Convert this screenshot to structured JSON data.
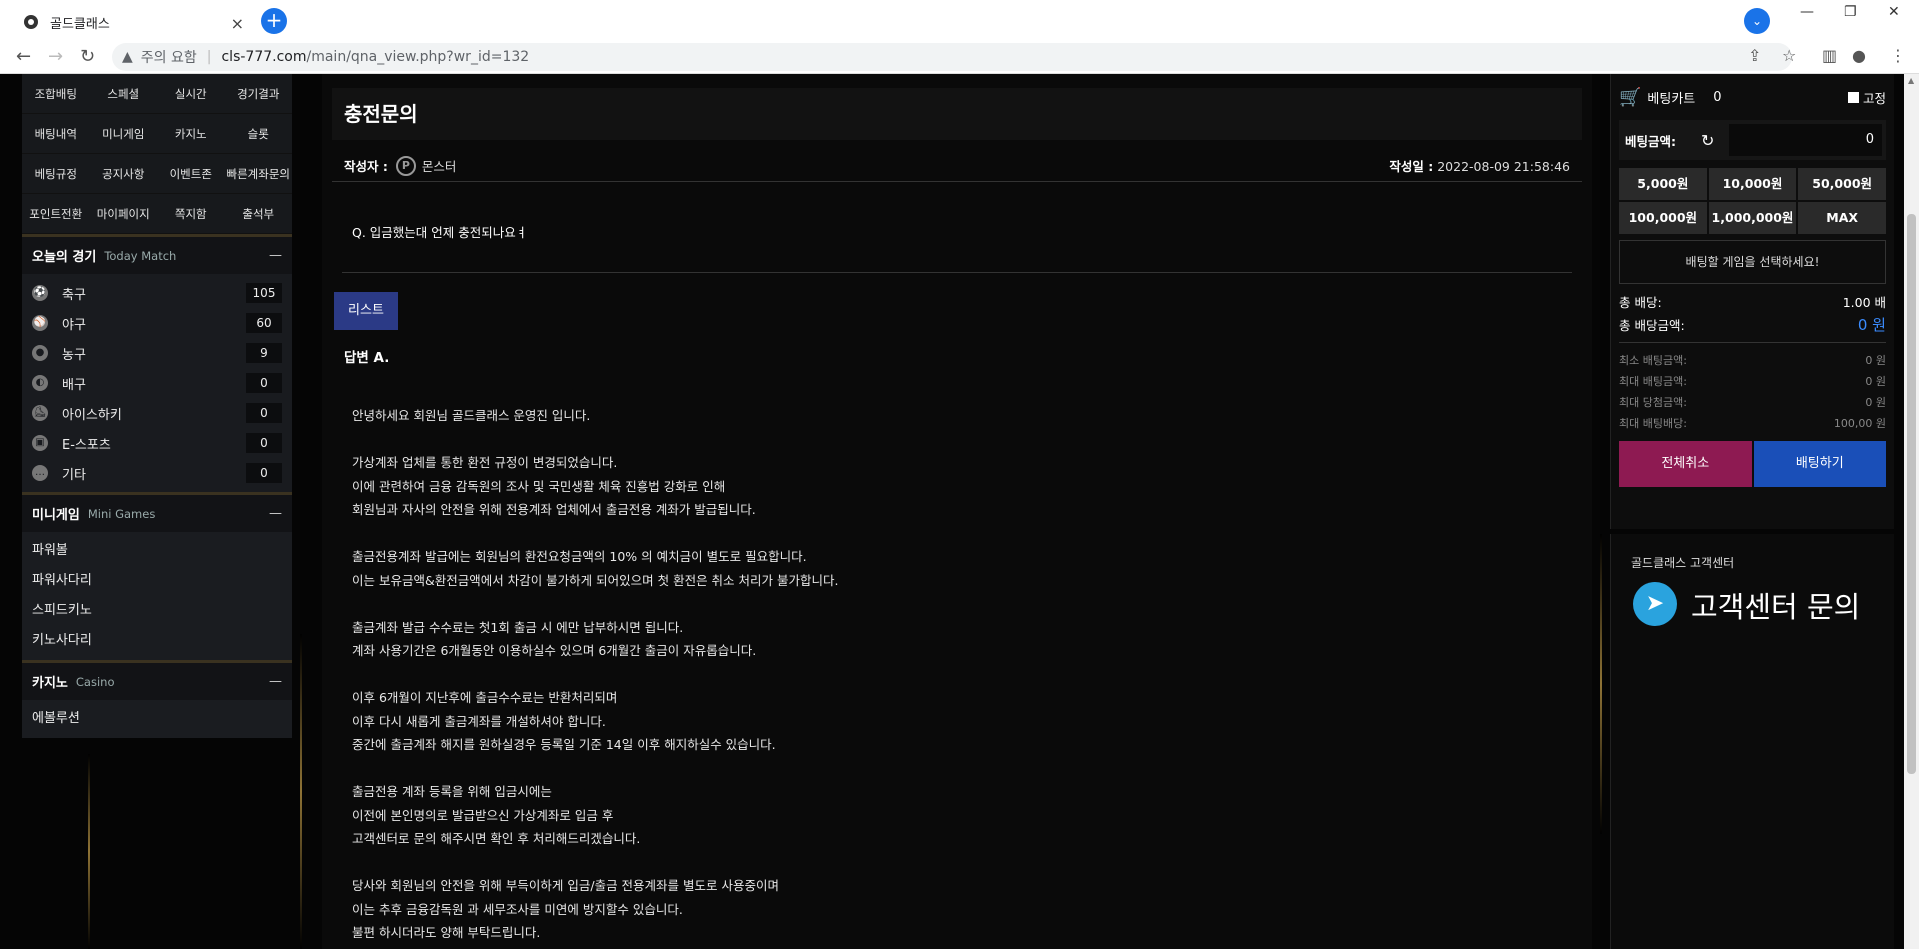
{
  "browser": {
    "tab_title": "골드클래스",
    "tab_close": "×",
    "new_tab": "+",
    "security_label": "주의 요함",
    "url_host": "cls-777.com",
    "url_path": "/main/qna_view.php?wr_id=132"
  },
  "nav_menu": [
    "조합배팅",
    "스페셜",
    "실시간",
    "경기결과",
    "배팅내역",
    "미니게임",
    "카지노",
    "슬롯",
    "베팅규정",
    "공지사항",
    "이벤트존",
    "빠른계좌문의",
    "포인트전환",
    "마이페이지",
    "쪽지함",
    "출석부"
  ],
  "today": {
    "title": "오늘의 경기",
    "sub": "Today Match",
    "toggle": "—",
    "sports": [
      {
        "name": "축구",
        "count": "105",
        "icon": "soccer-icon"
      },
      {
        "name": "야구",
        "count": "60",
        "icon": "baseball-icon"
      },
      {
        "name": "농구",
        "count": "9",
        "icon": "basketball-icon"
      },
      {
        "name": "배구",
        "count": "0",
        "icon": "volleyball-icon"
      },
      {
        "name": "아이스하키",
        "count": "0",
        "icon": "skate-icon"
      },
      {
        "name": "E-스포츠",
        "count": "0",
        "icon": "esports-icon"
      },
      {
        "name": "기타",
        "count": "0",
        "icon": "more-icon"
      }
    ]
  },
  "minigames": {
    "title": "미니게임",
    "sub": "Mini Games",
    "toggle": "—",
    "items": [
      "파워볼",
      "파워사다리",
      "스피드키노",
      "키노사다리"
    ]
  },
  "casino": {
    "title": "카지노",
    "sub": "Casino",
    "toggle": "—",
    "items": [
      "에볼루션"
    ]
  },
  "post": {
    "title": "충전문의",
    "author_label": "작성자 :",
    "author_badge": "P",
    "author": "몬스터",
    "date_label": "작성일 :",
    "date": "2022-08-09 21:58:46",
    "question": "Q. 입금했는대 언제 충전되나요ㅕ",
    "list_button": "리스트",
    "answer_head": "답변 A.",
    "answer_lines": [
      "안녕하세요 회원님 골드클래스 운영진 입니다.",
      "",
      "가상계좌 업체를 통한 환전 규정이 변경되었습니다.",
      "이에 관련하여 금융 감독원의 조사 및 국민생활 체육 진흥법 강화로 인해",
      "회원님과 자사의 안전을 위해 전용계좌 업체에서 출금전용 계좌가 발급됩니다.",
      "",
      "출금전용계좌 발급에는 회원님의 환전요청금액의 10% 의 예치금이 별도로 필요합니다.",
      "이는 보유금액&환전금액에서 차감이 불가하게 되어있으며 첫 환전은 취소 처리가 불가합니다.",
      "",
      "출금계좌 발급 수수료는 첫1회 출금 시 에만 납부하시면 됩니다.",
      "계좌 사용기간은 6개월동안 이용하실수 있으며 6개월간 출금이 자유롭습니다.",
      "",
      "이후 6개월이 지난후에 출금수수료는 반환처리되며",
      "이후 다시 새롭게 출금계좌를 개설하셔야 합니다.",
      "중간에 출금계좌 해지를 원하실경우 등록일 기준 14일 이후 해지하실수 있습니다.",
      "",
      "출금전용 계좌 등록을 위해 입금시에는",
      "이전에 본인명의로 발급받으신 가상계좌로 입금 후",
      "고객센터로 문의 해주시면 확인 후 처리해드리겠습니다.",
      "",
      "당사와 회원님의 안전을 위해 부득이하게 입금/출금 전용계좌를 별도로 사용중이며",
      "이는 추후 금융감독원 과 세무조사를 미연에 방지할수 있습니다.",
      "불편 하시더라도 양해 부탁드립니다."
    ]
  },
  "betslip": {
    "cart_label": "베팅카트",
    "cart_count": "0",
    "fix_label": "고정",
    "amount_label": "베팅금액:",
    "amount_value": "0",
    "quick_amounts": [
      "5,000원",
      "10,000원",
      "50,000원",
      "100,000원",
      "1,000,000원",
      "MAX"
    ],
    "select_msg": "배팅할 게임을 선택하세요!",
    "total_odds_label": "총 배당:",
    "total_odds_value": "1.00 배",
    "total_payout_label": "총 배당금액:",
    "total_payout_value": "0 원",
    "limits": [
      {
        "label": "최소 배팅금액:",
        "value": "0 원"
      },
      {
        "label": "최대 배팅금액:",
        "value": "0 원"
      },
      {
        "label": "최대 당첨금액:",
        "value": "0 원"
      },
      {
        "label": "최대 배팅배당:",
        "value": "100,00 원"
      }
    ],
    "cancel_all": "전체취소",
    "place_bet": "배팅하기"
  },
  "support": {
    "small": "골드클래스 고객센터",
    "big": "고객센터 문의"
  }
}
